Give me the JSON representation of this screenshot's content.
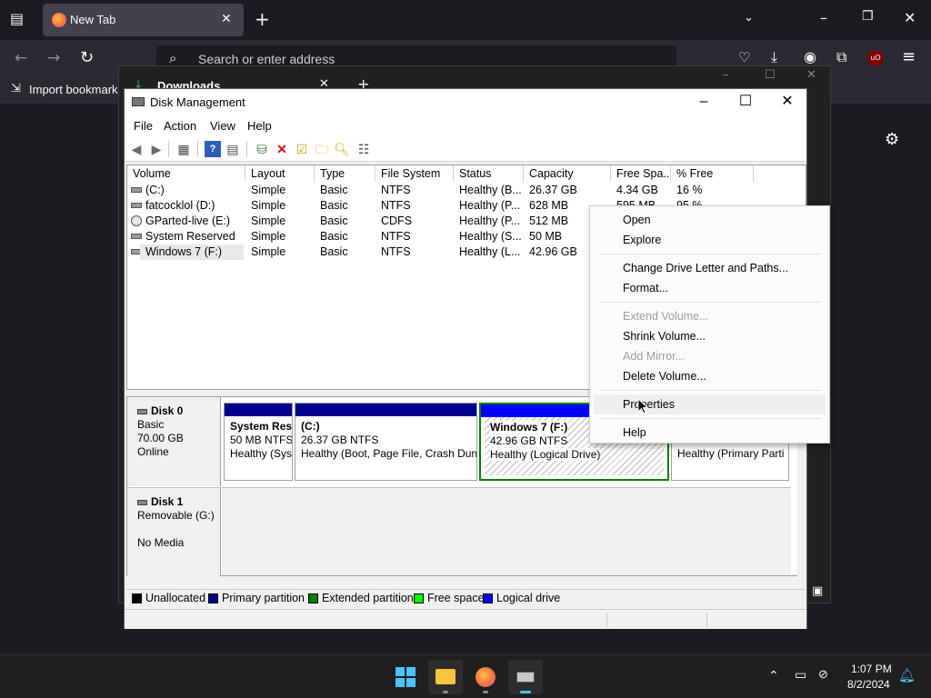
{
  "firefox": {
    "tab_title": "New Tab",
    "url_placeholder": "Search or enter address",
    "bookmarks_label": "Import bookmarks...",
    "icons": [
      "tab-list-icon",
      "firefox-icon",
      "close-icon",
      "new-tab-icon",
      "chevron-down-icon",
      "minimize-icon",
      "restore-icon",
      "back-icon",
      "forward-icon",
      "reload-icon",
      "search-icon",
      "pocket-icon",
      "downloads-icon",
      "account-icon",
      "extensions-icon",
      "ublock-icon",
      "menu-icon",
      "gear-icon"
    ]
  },
  "downloads_window": {
    "title": "Downloads"
  },
  "disk_management": {
    "title": "Disk Management",
    "menu": [
      "File",
      "Action",
      "View",
      "Help"
    ],
    "columns": [
      "Volume",
      "Layout",
      "Type",
      "File System",
      "Status",
      "Capacity",
      "Free Spa...",
      "% Free"
    ],
    "rows": [
      {
        "volume": "(C:)",
        "layout": "Simple",
        "type": "Basic",
        "fs": "NTFS",
        "status": "Healthy (B...",
        "capacity": "26.37 GB",
        "free": "4.34 GB",
        "pct": "16 %"
      },
      {
        "volume": "fatcocklol (D:)",
        "layout": "Simple",
        "type": "Basic",
        "fs": "NTFS",
        "status": "Healthy (P...",
        "capacity": "628 MB",
        "free": "595 MB",
        "pct": "95 %"
      },
      {
        "volume": "GParted-live (E:)",
        "layout": "Simple",
        "type": "Basic",
        "fs": "CDFS",
        "status": "Healthy (P...",
        "capacity": "512 MB",
        "free": "",
        "pct": ""
      },
      {
        "volume": "System Reserved",
        "layout": "Simple",
        "type": "Basic",
        "fs": "NTFS",
        "status": "Healthy (S...",
        "capacity": "50 MB",
        "free": "",
        "pct": ""
      },
      {
        "volume": "Windows 7 (F:)",
        "layout": "Simple",
        "type": "Basic",
        "fs": "NTFS",
        "status": "Healthy (L...",
        "capacity": "42.96 GB",
        "free": "",
        "pct": ""
      }
    ],
    "disks": [
      {
        "name": "Disk 0",
        "type": "Basic",
        "size": "70.00 GB",
        "state": "Online",
        "partitions": [
          {
            "name": "System Res",
            "size": "50 MB NTFS",
            "status": "Healthy (Sys"
          },
          {
            "name": "(C:)",
            "size": "26.37 GB NTFS",
            "status": "Healthy (Boot, Page File, Crash Dun"
          },
          {
            "name": "Windows 7  (F:)",
            "size": "42.96 GB NTFS",
            "status": "Healthy (Logical Drive)"
          },
          {
            "name": "",
            "size": "",
            "status": "Healthy (Primary Parti"
          }
        ]
      },
      {
        "name": "Disk 1",
        "type": "Removable (G:)",
        "size": "",
        "state": "No Media",
        "partitions": []
      }
    ],
    "legend": [
      "Unallocated",
      "Primary partition",
      "Extended partition",
      "Free space",
      "Logical drive"
    ],
    "colors": {
      "unallocated": "#000000",
      "primary": "#00008b",
      "extended": "#008000",
      "free": "#00ff00",
      "logical": "#0000ff"
    }
  },
  "context_menu": {
    "items": [
      "Open",
      "Explore",
      "Change Drive Letter and Paths...",
      "Format...",
      "Extend Volume...",
      "Shrink Volume...",
      "Add Mirror...",
      "Delete Volume...",
      "Properties",
      "Help"
    ],
    "disabled": [
      "Extend Volume...",
      "Add Mirror..."
    ],
    "highlighted": "Properties"
  },
  "taskbar": {
    "apps": [
      "start-icon",
      "file-explorer-icon",
      "firefox-icon",
      "disk-management-icon"
    ],
    "time": "1:07 PM",
    "date": "8/2/2024"
  }
}
